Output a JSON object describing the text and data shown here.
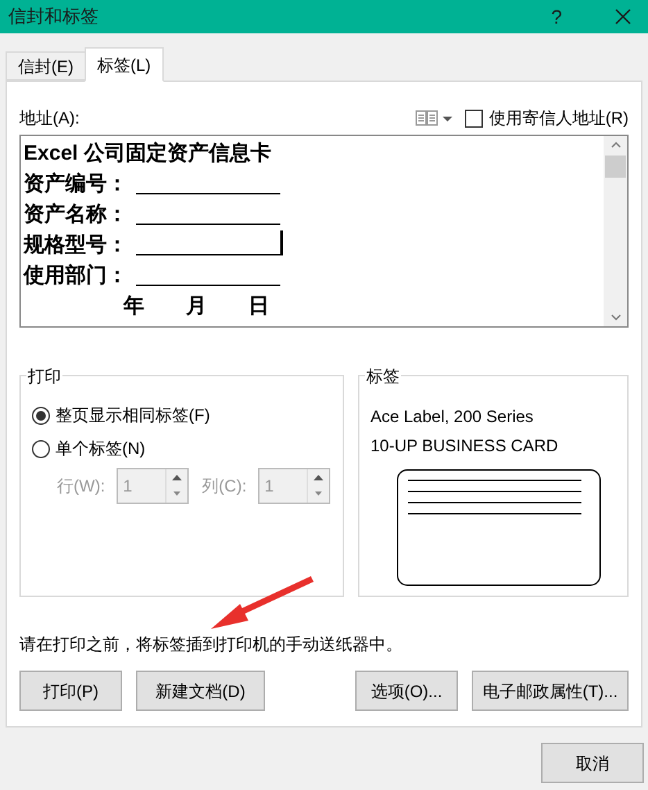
{
  "window": {
    "title": "信封和标签",
    "help": "?"
  },
  "tabs": [
    {
      "label": "信封(E)",
      "selected": false
    },
    {
      "label": "标签(L)",
      "selected": true
    }
  ],
  "address": {
    "label": "地址(A):",
    "use_return_address": {
      "label": "使用寄信人地址(R)",
      "checked": false
    },
    "lines": [
      {
        "text": "Excel 公司固定资产信息卡",
        "blank": false,
        "cursor": false
      },
      {
        "text": "资产编号：",
        "blank": true,
        "cursor": false
      },
      {
        "text": "资产名称：",
        "blank": true,
        "cursor": false
      },
      {
        "text": "规格型号：",
        "blank": true,
        "cursor": true
      },
      {
        "text": "使用部门：",
        "blank": true,
        "cursor": false
      },
      {
        "text": "年　　月　　日",
        "blank": false,
        "cursor": false
      }
    ]
  },
  "print": {
    "title": "打印",
    "options": [
      {
        "label": "整页显示相同标签(F)",
        "selected": true
      },
      {
        "label": "单个标签(N)",
        "selected": false
      }
    ],
    "spinners": [
      {
        "label": "行(W):",
        "value": "1",
        "disabled": true
      },
      {
        "label": "列(C):",
        "value": "1",
        "disabled": true
      }
    ]
  },
  "label": {
    "title": "标签",
    "lines": [
      "Ace Label, 200 Series",
      "10-UP BUSINESS CARD"
    ]
  },
  "note": "请在打印之前，将标签插到打印机的手动送纸器中。",
  "buttons": [
    "打印(P)",
    "新建文档(D)",
    "选项(O)...",
    "电子邮政属性(T)..."
  ],
  "footer_buttons": [
    "取消"
  ]
}
